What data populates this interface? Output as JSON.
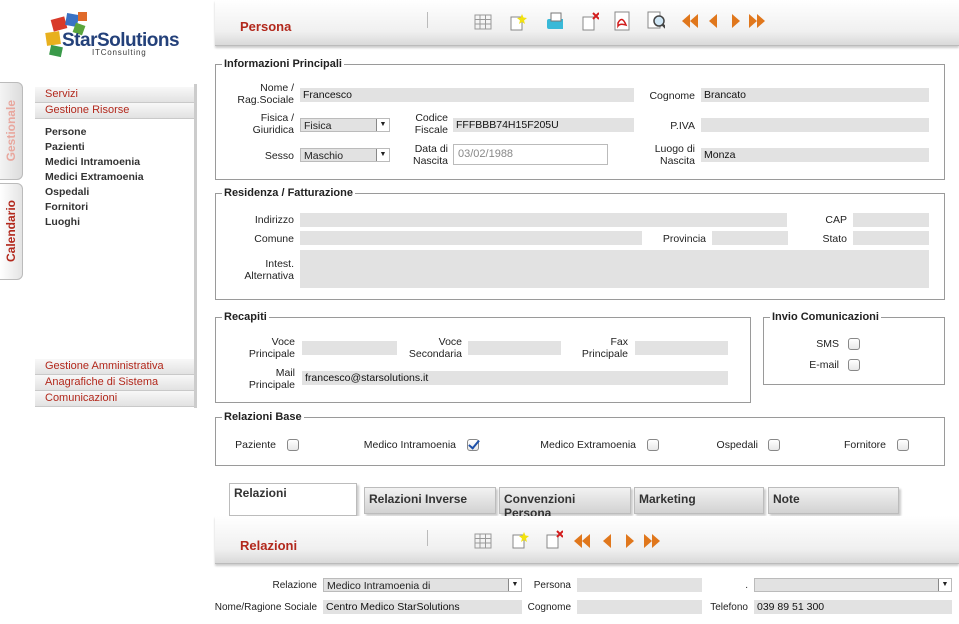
{
  "brand": {
    "name": "StarSolutions",
    "tagline": "ITConsulting"
  },
  "side_tabs": {
    "gestionale": "Gestionale",
    "calendario": "Calendario"
  },
  "sidebar": {
    "servizi": "Servizi",
    "gestione_risorse": "Gestione Risorse",
    "items": [
      "Persone",
      "Pazienti",
      "Medici Intramoenia",
      "Medici Extramoenia",
      "Ospedali",
      "Fornitori",
      "Luoghi"
    ],
    "gestione_amministrativa": "Gestione Amministrativa",
    "anagrafiche": "Anagrafiche di Sistema",
    "comunicazioni": "Comunicazioni"
  },
  "header": {
    "title": "Persona"
  },
  "info": {
    "legend": "Informazioni Principali",
    "nome_label_1": "Nome /",
    "nome_label_2": "Rag.Sociale",
    "nome_value": "Francesco",
    "cognome_label": "Cognome",
    "cognome_value": "Brancato",
    "tipo_label_1": "Fisica /",
    "tipo_label_2": "Giuridica",
    "tipo_value": "Fisica",
    "cf_label_1": "Codice",
    "cf_label_2": "Fiscale",
    "cf_value": "FFFBBB74H15F205U",
    "piva_label": "P.IVA",
    "piva_value": "",
    "sesso_label": "Sesso",
    "sesso_value": "Maschio",
    "data_label_1": "Data di",
    "data_label_2": "Nascita",
    "data_value": "03/02/1988",
    "luogo_label_1": "Luogo di",
    "luogo_label_2": "Nascita",
    "luogo_value": "Monza"
  },
  "residenza": {
    "legend": "Residenza / Fatturazione",
    "indirizzo_label": "Indirizzo",
    "cap_label": "CAP",
    "comune_label": "Comune",
    "provincia_label": "Provincia",
    "stato_label": "Stato",
    "intest_label_1": "Intest.",
    "intest_label_2": "Alternativa"
  },
  "recapiti": {
    "legend": "Recapiti",
    "voce_p_1": "Voce",
    "voce_p_2": "Principale",
    "voce_s_1": "Voce",
    "voce_s_2": "Secondaria",
    "fax_1": "Fax",
    "fax_2": "Principale",
    "mail_1": "Mail",
    "mail_2": "Principale",
    "mail_value": "francesco@starsolutions.it"
  },
  "invio": {
    "legend": "Invio Comunicazioni",
    "sms": "SMS",
    "email": "E-mail"
  },
  "relazioni_base": {
    "legend": "Relazioni Base",
    "items": [
      {
        "label": "Paziente",
        "checked": false
      },
      {
        "label": "Medico Intramoenia",
        "checked": true
      },
      {
        "label": "Medico Extramoenia",
        "checked": false
      },
      {
        "label": "Ospedali",
        "checked": false
      },
      {
        "label": "Fornitore",
        "checked": false
      }
    ]
  },
  "tabs": [
    "Relazioni",
    "Relazioni Inverse",
    "Convenzioni Persona",
    "Marketing",
    "Note"
  ],
  "relazioni": {
    "title": "Relazioni",
    "relazione_label": "Relazione",
    "relazione_value": "Medico Intramoenia di",
    "persona_label": "Persona",
    "dot_label": ".",
    "nome_label": "Nome/Ragione Sociale",
    "nome_value": "Centro Medico StarSolutions",
    "cognome_label": "Cognome",
    "telefono_label": "Telefono",
    "telefono_value": "039 89 51 300"
  },
  "colors": {
    "accent": "#b2281c",
    "arrow": "#e0771c",
    "field": "#e2e2e2"
  }
}
